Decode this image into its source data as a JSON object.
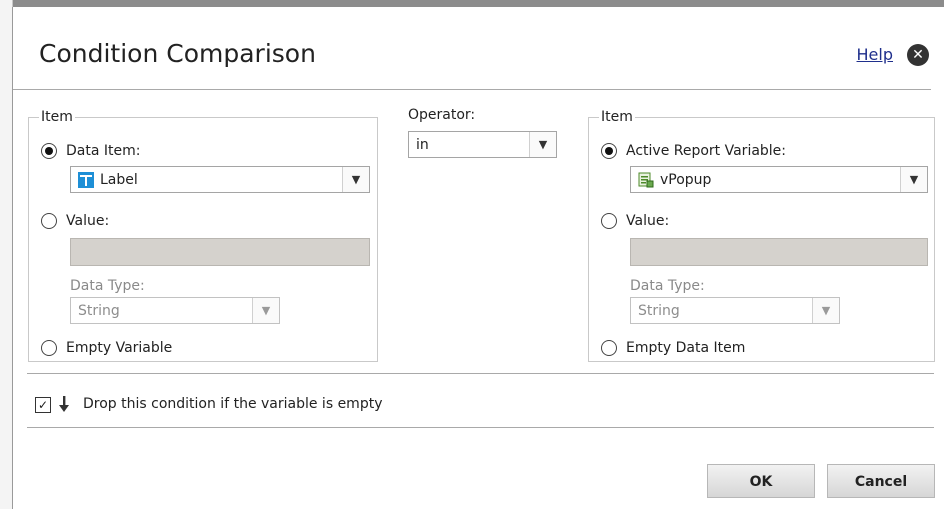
{
  "dialog": {
    "title": "Condition Comparison",
    "help_label": "Help",
    "close_glyph": "✕"
  },
  "left_item": {
    "legend": "Item",
    "data_item_label": "Data Item:",
    "data_item_value": "Label",
    "data_item_icon": "data-item-icon",
    "value_label": "Value:",
    "value_input": "",
    "data_type_label": "Data Type:",
    "data_type_value": "String",
    "empty_label": "Empty Variable",
    "selected": "data_item"
  },
  "operator": {
    "label": "Operator:",
    "value": "in"
  },
  "right_item": {
    "legend": "Item",
    "variable_label": "Active Report Variable:",
    "variable_value": "vPopup",
    "variable_icon": "report-variable-icon",
    "value_label": "Value:",
    "value_input": "",
    "data_type_label": "Data Type:",
    "data_type_value": "String",
    "empty_label": "Empty Data Item",
    "selected": "variable"
  },
  "drop_condition": {
    "checked": true,
    "label": "Drop this condition if the variable is empty"
  },
  "buttons": {
    "ok": "OK",
    "cancel": "Cancel"
  },
  "colors": {
    "link": "#1f2f8c",
    "disabled_field": "#d5d2cd",
    "border": "#c9c9c9"
  }
}
